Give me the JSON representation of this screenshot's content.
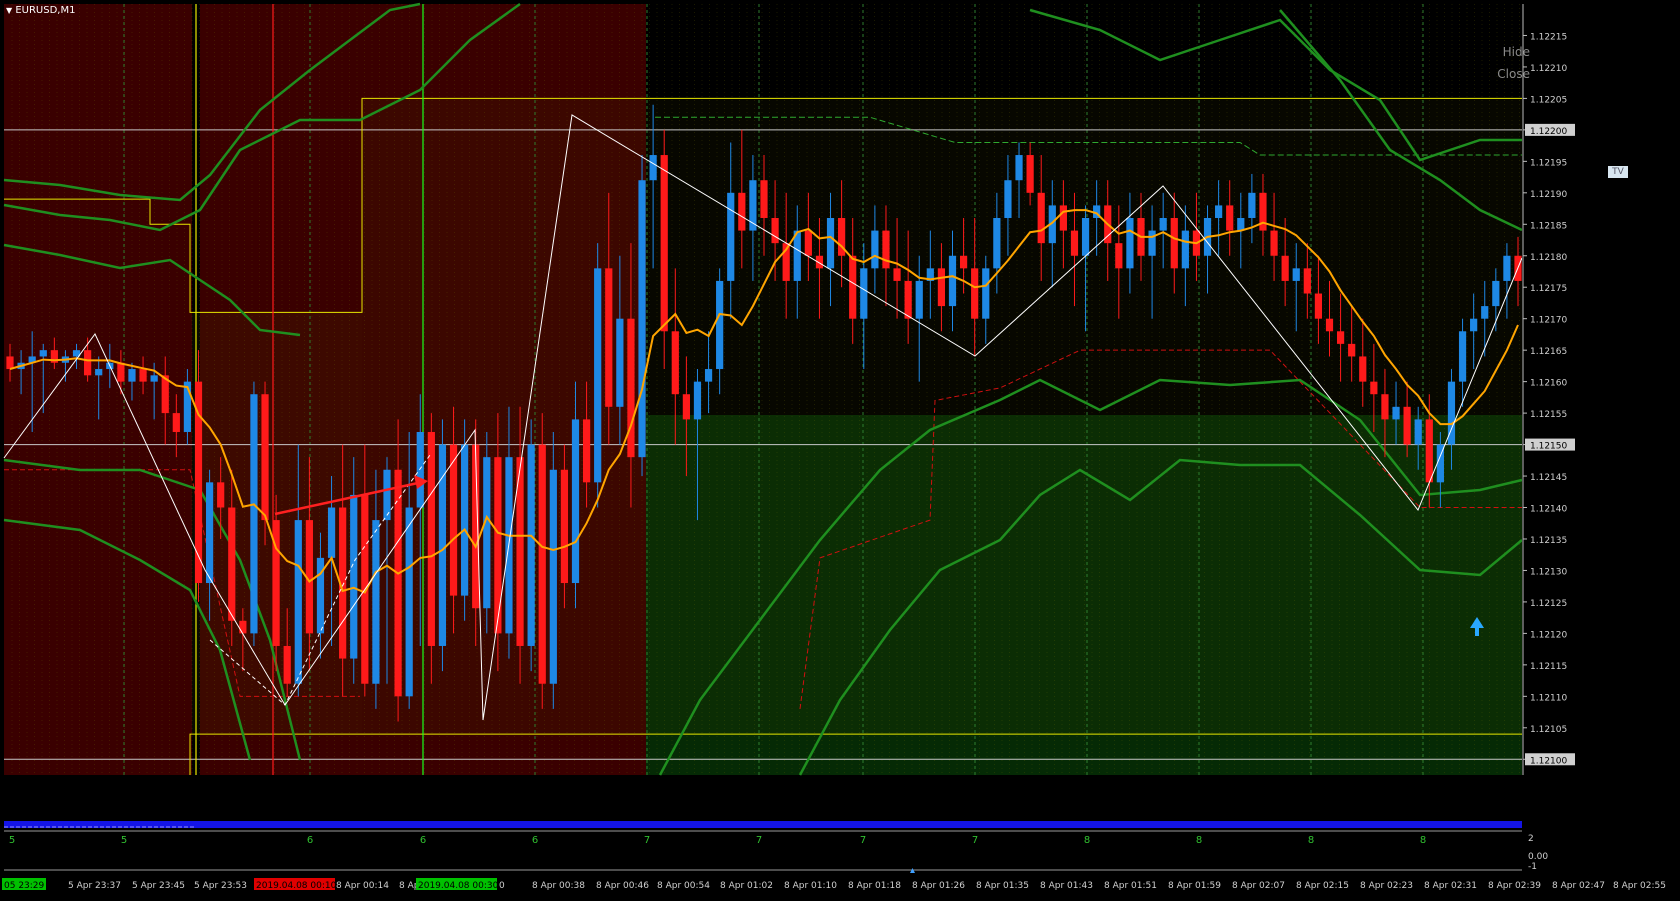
{
  "symbol": "EURUSD,M1",
  "buttons": {
    "hide": "Hide",
    "close": "Close",
    "tv": "TV"
  },
  "price_axis": {
    "labels": [
      "1.12215",
      "1.12210",
      "1.12205",
      "1.12200",
      "1.12195",
      "1.12190",
      "1.12185",
      "1.12180",
      "1.12175",
      "1.12170",
      "1.12165",
      "1.12160",
      "1.12155",
      "1.12150",
      "1.12145",
      "1.12140",
      "1.12135",
      "1.12130",
      "1.12125",
      "1.12120",
      "1.12115",
      "1.12110",
      "1.12105",
      "1.12100"
    ],
    "highlighted": [
      "1.12200",
      "1.12150",
      "1.12100"
    ]
  },
  "subwindow": {
    "day_labels": [
      "5",
      "5",
      "6",
      "6",
      "6",
      "7",
      "7",
      "7",
      "7",
      "8",
      "8",
      "8",
      "8"
    ],
    "axis_labels": [
      "2",
      "0.00",
      "-1"
    ]
  },
  "time_axis": {
    "left_badge": "05 23:29",
    "labels": [
      "5 Apr 23:37",
      "5 Apr 23:45",
      "5 Apr 23:53",
      "8 Apr 00:14",
      "8 Apr",
      "8 Apr 00:38",
      "8 Apr 00:46",
      "8 Apr 00:54",
      "8 Apr 01:02",
      "8 Apr 01:10",
      "8 Apr 01:18",
      "8 Apr 01:26",
      "8 Apr 01:35",
      "8 Apr 01:43",
      "8 Apr 01:51",
      "8 Apr 01:59",
      "8 Apr 02:07",
      "8 Apr 02:15",
      "8 Apr 02:23",
      "8 Apr 02:31",
      "8 Apr 02:39",
      "8 Apr 02:47",
      "8 Apr 02:55"
    ],
    "badges": [
      {
        "text": "2019.04.08 00:10",
        "color": "#e00000"
      },
      {
        "text": "2019.04.08 00:30",
        "color": "#00c000"
      }
    ],
    "trailing_digit": "0"
  },
  "colors": {
    "background": "#000000",
    "session_bg": "#3a0000",
    "bull": "#1e88e5",
    "bear": "#ff1a1a",
    "ma": "#ffa500",
    "zigzag": "#ffffff",
    "channel": "#1f8f1f",
    "level": "#e8e800",
    "axis_text": "#d0d0d0"
  },
  "chart_data": {
    "type": "candlestick",
    "ylim": [
      1.120975,
      1.1222
    ],
    "grid": true,
    "horizontal_levels": [
      1.122,
      1.1215,
      1.121
    ],
    "candles": [
      [
        1.12164,
        1.12166,
        1.1216,
        1.12162
      ],
      [
        1.12162,
        1.12165,
        1.12158,
        1.12163
      ],
      [
        1.12163,
        1.12168,
        1.12152,
        1.12164
      ],
      [
        1.12164,
        1.12166,
        1.12155,
        1.12165
      ],
      [
        1.12165,
        1.12167,
        1.12162,
        1.12163
      ],
      [
        1.12163,
        1.12165,
        1.1216,
        1.12164
      ],
      [
        1.12164,
        1.12166,
        1.12162,
        1.12165
      ],
      [
        1.12165,
        1.12167,
        1.1216,
        1.12161
      ],
      [
        1.12161,
        1.12164,
        1.12154,
        1.12162
      ],
      [
        1.12162,
        1.12166,
        1.12159,
        1.12163
      ],
      [
        1.12163,
        1.12165,
        1.12158,
        1.1216
      ],
      [
        1.1216,
        1.12163,
        1.12157,
        1.12162
      ],
      [
        1.12162,
        1.12164,
        1.12158,
        1.1216
      ],
      [
        1.1216,
        1.12163,
        1.12154,
        1.12161
      ],
      [
        1.12161,
        1.12164,
        1.1215,
        1.12155
      ],
      [
        1.12155,
        1.12158,
        1.12148,
        1.12152
      ],
      [
        1.12152,
        1.12162,
        1.1215,
        1.1216
      ],
      [
        1.1216,
        1.12165,
        1.12125,
        1.12128
      ],
      [
        1.12128,
        1.12146,
        1.12122,
        1.12144
      ],
      [
        1.12144,
        1.12148,
        1.12135,
        1.1214
      ],
      [
        1.1214,
        1.12146,
        1.12118,
        1.12122
      ],
      [
        1.12122,
        1.12124,
        1.12114,
        1.1212
      ],
      [
        1.1212,
        1.1216,
        1.12118,
        1.12158
      ],
      [
        1.12158,
        1.1216,
        1.12134,
        1.12138
      ],
      [
        1.12138,
        1.12142,
        1.12114,
        1.12118
      ],
      [
        1.12118,
        1.12124,
        1.1211,
        1.12112
      ],
      [
        1.12112,
        1.1215,
        1.1211,
        1.12138
      ],
      [
        1.12138,
        1.12148,
        1.12114,
        1.1212
      ],
      [
        1.1212,
        1.12136,
        1.12116,
        1.12132
      ],
      [
        1.12132,
        1.12145,
        1.12118,
        1.1214
      ],
      [
        1.1214,
        1.1215,
        1.1211,
        1.12116
      ],
      [
        1.12116,
        1.12148,
        1.12112,
        1.12142
      ],
      [
        1.12142,
        1.1215,
        1.1211,
        1.12112
      ],
      [
        1.12112,
        1.12146,
        1.12108,
        1.12138
      ],
      [
        1.12138,
        1.12148,
        1.12112,
        1.12146
      ],
      [
        1.12146,
        1.12154,
        1.12106,
        1.1211
      ],
      [
        1.1211,
        1.12152,
        1.12108,
        1.1214
      ],
      [
        1.1214,
        1.12158,
        1.12118,
        1.12152
      ],
      [
        1.12152,
        1.12155,
        1.12112,
        1.12118
      ],
      [
        1.12118,
        1.12154,
        1.12114,
        1.1215
      ],
      [
        1.1215,
        1.12156,
        1.1212,
        1.12126
      ],
      [
        1.12126,
        1.12154,
        1.12122,
        1.1215
      ],
      [
        1.1215,
        1.12154,
        1.12118,
        1.12124
      ],
      [
        1.12124,
        1.12152,
        1.1212,
        1.12148
      ],
      [
        1.12148,
        1.12155,
        1.12114,
        1.1212
      ],
      [
        1.1212,
        1.12156,
        1.12116,
        1.12148
      ],
      [
        1.12148,
        1.12156,
        1.12112,
        1.12118
      ],
      [
        1.12118,
        1.12154,
        1.12114,
        1.1215
      ],
      [
        1.1215,
        1.12155,
        1.12108,
        1.12112
      ],
      [
        1.12112,
        1.12152,
        1.12108,
        1.12146
      ],
      [
        1.12146,
        1.1215,
        1.12124,
        1.12128
      ],
      [
        1.12128,
        1.1216,
        1.12124,
        1.12154
      ],
      [
        1.12154,
        1.1216,
        1.1214,
        1.12144
      ],
      [
        1.12144,
        1.12182,
        1.1214,
        1.12178
      ],
      [
        1.12178,
        1.1219,
        1.1215,
        1.12156
      ],
      [
        1.12156,
        1.1218,
        1.1215,
        1.1217
      ],
      [
        1.1217,
        1.12182,
        1.1214,
        1.12148
      ],
      [
        1.12148,
        1.12196,
        1.12145,
        1.12192
      ],
      [
        1.12192,
        1.12204,
        1.12178,
        1.12196
      ],
      [
        1.12196,
        1.122,
        1.12162,
        1.12168
      ],
      [
        1.12168,
        1.12178,
        1.1215,
        1.12158
      ],
      [
        1.12158,
        1.12164,
        1.12145,
        1.12154
      ],
      [
        1.12154,
        1.12162,
        1.12138,
        1.1216
      ],
      [
        1.1216,
        1.12168,
        1.12155,
        1.12162
      ],
      [
        1.12162,
        1.12178,
        1.12158,
        1.12176
      ],
      [
        1.12176,
        1.12198,
        1.1217,
        1.1219
      ],
      [
        1.1219,
        1.122,
        1.12178,
        1.12184
      ],
      [
        1.12184,
        1.12196,
        1.12176,
        1.12192
      ],
      [
        1.12192,
        1.12196,
        1.1218,
        1.12186
      ],
      [
        1.12186,
        1.12192,
        1.12176,
        1.12182
      ],
      [
        1.12182,
        1.1219,
        1.1217,
        1.12176
      ],
      [
        1.12176,
        1.12188,
        1.1217,
        1.12184
      ],
      [
        1.12184,
        1.1219,
        1.12176,
        1.1218
      ],
      [
        1.1218,
        1.12186,
        1.1217,
        1.12178
      ],
      [
        1.12178,
        1.1219,
        1.12172,
        1.12186
      ],
      [
        1.12186,
        1.12192,
        1.12175,
        1.1218
      ],
      [
        1.1218,
        1.12186,
        1.12166,
        1.1217
      ],
      [
        1.1217,
        1.12182,
        1.12162,
        1.12178
      ],
      [
        1.12178,
        1.12188,
        1.12174,
        1.12184
      ],
      [
        1.12184,
        1.12188,
        1.12172,
        1.12178
      ],
      [
        1.12178,
        1.12186,
        1.1217,
        1.12176
      ],
      [
        1.12176,
        1.12184,
        1.12166,
        1.1217
      ],
      [
        1.1217,
        1.1218,
        1.1216,
        1.12176
      ],
      [
        1.12176,
        1.12184,
        1.1217,
        1.12178
      ],
      [
        1.12178,
        1.12182,
        1.12168,
        1.12172
      ],
      [
        1.12172,
        1.12184,
        1.12168,
        1.1218
      ],
      [
        1.1218,
        1.12186,
        1.12174,
        1.12178
      ],
      [
        1.12178,
        1.12186,
        1.12164,
        1.1217
      ],
      [
        1.1217,
        1.1218,
        1.12166,
        1.12178
      ],
      [
        1.12178,
        1.1219,
        1.12174,
        1.12186
      ],
      [
        1.12186,
        1.12196,
        1.1218,
        1.12192
      ],
      [
        1.12192,
        1.12198,
        1.12186,
        1.12196
      ],
      [
        1.12196,
        1.12198,
        1.12188,
        1.1219
      ],
      [
        1.1219,
        1.12196,
        1.12176,
        1.12182
      ],
      [
        1.12182,
        1.12192,
        1.12175,
        1.12188
      ],
      [
        1.12188,
        1.12192,
        1.12178,
        1.12184
      ],
      [
        1.12184,
        1.1219,
        1.12172,
        1.1218
      ],
      [
        1.1218,
        1.12188,
        1.12168,
        1.12186
      ],
      [
        1.12186,
        1.12192,
        1.1218,
        1.12188
      ],
      [
        1.12188,
        1.12192,
        1.12176,
        1.12182
      ],
      [
        1.12182,
        1.12188,
        1.1217,
        1.12178
      ],
      [
        1.12178,
        1.1219,
        1.12174,
        1.12186
      ],
      [
        1.12186,
        1.1219,
        1.12176,
        1.1218
      ],
      [
        1.1218,
        1.12188,
        1.1217,
        1.12184
      ],
      [
        1.12184,
        1.1219,
        1.12178,
        1.12186
      ],
      [
        1.12186,
        1.1219,
        1.12174,
        1.12178
      ],
      [
        1.12178,
        1.12188,
        1.12172,
        1.12184
      ],
      [
        1.12184,
        1.1219,
        1.12176,
        1.1218
      ],
      [
        1.1218,
        1.12188,
        1.12174,
        1.12186
      ],
      [
        1.12186,
        1.12192,
        1.1218,
        1.12188
      ],
      [
        1.12188,
        1.12192,
        1.1218,
        1.12184
      ],
      [
        1.12184,
        1.1219,
        1.12178,
        1.12186
      ],
      [
        1.12186,
        1.12193,
        1.12182,
        1.1219
      ],
      [
        1.1219,
        1.12193,
        1.1218,
        1.12184
      ],
      [
        1.12184,
        1.1219,
        1.12176,
        1.1218
      ],
      [
        1.1218,
        1.12186,
        1.12172,
        1.12176
      ],
      [
        1.12176,
        1.12182,
        1.12168,
        1.12178
      ],
      [
        1.12178,
        1.12182,
        1.1217,
        1.12174
      ],
      [
        1.12174,
        1.1218,
        1.12166,
        1.1217
      ],
      [
        1.1217,
        1.12176,
        1.12164,
        1.12168
      ],
      [
        1.12168,
        1.12174,
        1.1216,
        1.12166
      ],
      [
        1.12166,
        1.12172,
        1.1216,
        1.12164
      ],
      [
        1.12164,
        1.1217,
        1.12156,
        1.1216
      ],
      [
        1.1216,
        1.12166,
        1.12152,
        1.12158
      ],
      [
        1.12158,
        1.12162,
        1.12148,
        1.12154
      ],
      [
        1.12154,
        1.1216,
        1.1215,
        1.12156
      ],
      [
        1.12156,
        1.1216,
        1.12148,
        1.1215
      ],
      [
        1.1215,
        1.12156,
        1.12146,
        1.12154
      ],
      [
        1.12154,
        1.12158,
        1.1214,
        1.12144
      ],
      [
        1.12144,
        1.12152,
        1.1214,
        1.1215
      ],
      [
        1.1215,
        1.12162,
        1.12146,
        1.1216
      ],
      [
        1.1216,
        1.1217,
        1.12156,
        1.12168
      ],
      [
        1.12168,
        1.12174,
        1.12162,
        1.1217
      ],
      [
        1.1217,
        1.12176,
        1.12164,
        1.12172
      ],
      [
        1.12172,
        1.12178,
        1.12168,
        1.12176
      ],
      [
        1.12176,
        1.12182,
        1.1217,
        1.1218
      ],
      [
        1.1218,
        1.12183,
        1.12172,
        1.12176
      ]
    ]
  }
}
